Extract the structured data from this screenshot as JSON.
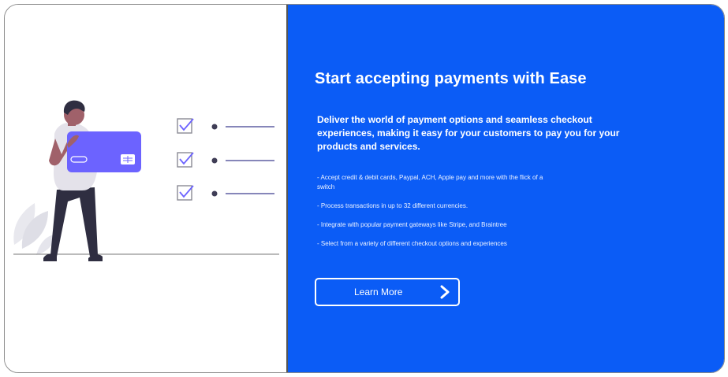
{
  "hero": {
    "title": "Start accepting payments with Ease",
    "lead": "Deliver the world of payment options and seamless checkout experiences, making it easy for your customers to pay you for your products and services.",
    "features": [
      "- Accept credit & debit cards, Paypal, ACH, Apple pay and more with the flick of a switch",
      "- Process transactions in up to 32 different currencies.",
      "- Integrate with popular payment gateways like Stripe, and Braintree",
      "- Select from a variety of different checkout options and experiences"
    ],
    "cta_label": "Learn More"
  },
  "colors": {
    "accent": "#0b5cf6",
    "card": "#6c63ff",
    "checklist_line": "#3f3d8f"
  },
  "icons": {
    "cta": "chevron-right-icon",
    "checklist": "checkbox-checked-icon"
  }
}
